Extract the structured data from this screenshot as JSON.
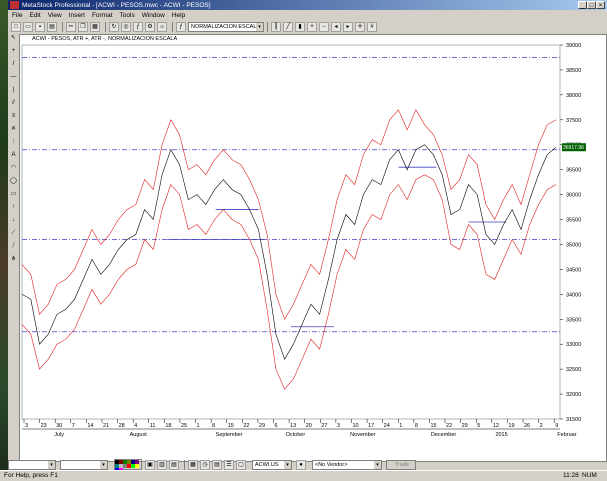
{
  "app": {
    "title": "MetaStock Professional - [ACWI - PESOS.mwc - ACWI - PESOS]"
  },
  "menu": [
    "File",
    "Edit",
    "View",
    "Insert",
    "Format",
    "Tools",
    "Window",
    "Help"
  ],
  "toolbar": {
    "indicator_combo": "NORMALIZACION ESCALA"
  },
  "chart": {
    "header": "ACWI - PESOS, ATR +, ATR -, NORMALIZACION ESCALA",
    "last_value_label": "36917.96"
  },
  "chart_data": {
    "type": "line",
    "title": "ACWI - PESOS, ATR +, ATR -, NORMALIZACION ESCALA",
    "ylim": [
      31500,
      39000
    ],
    "y_ticks": [
      31500,
      32000,
      32500,
      33000,
      33500,
      34000,
      34500,
      35000,
      35500,
      36000,
      36500,
      37000,
      37500,
      38000,
      38500,
      39000
    ],
    "x_tick_labels": [
      "3",
      "23",
      "30",
      "7",
      "14",
      "21",
      "28",
      "4",
      "11",
      "18",
      "25",
      "1",
      "8",
      "15",
      "22",
      "29",
      "6",
      "13",
      "20",
      "27",
      "3",
      "10",
      "17",
      "24",
      "1",
      "8",
      "15",
      "22",
      "29",
      "5",
      "12",
      "19",
      "26",
      "2",
      "9"
    ],
    "month_labels": [
      "July",
      "August",
      "September",
      "October",
      "November",
      "December",
      "2015",
      "Februar"
    ],
    "horizontal_levels": [
      38750,
      36900,
      35100,
      33250
    ],
    "support_segments": [
      {
        "from": 0.27,
        "to": 0.45,
        "y": 35100
      },
      {
        "from": 0.36,
        "to": 0.44,
        "y": 35700
      },
      {
        "from": 0.5,
        "to": 0.58,
        "y": 33350
      },
      {
        "from": 0.7,
        "to": 0.77,
        "y": 36550
      },
      {
        "from": 0.83,
        "to": 0.9,
        "y": 35450
      }
    ],
    "series": [
      {
        "values": [
          34000,
          33900,
          33000,
          33200,
          33600,
          33700,
          33900,
          34300,
          34700,
          34400,
          34600,
          34900,
          35100,
          35200,
          35700,
          35500,
          36400,
          36900,
          36600,
          35900,
          36000,
          35800,
          36100,
          36300,
          36100,
          36000,
          35700,
          35300,
          34400,
          33200,
          32700,
          33000,
          33400,
          33800,
          33600,
          34300,
          35100,
          35600,
          35400,
          36000,
          36300,
          36200,
          36700,
          36900,
          36500,
          36900,
          37000,
          36800,
          36400,
          35600,
          35700,
          36200,
          36000,
          35200,
          35000,
          35400,
          35700,
          35300,
          35900,
          36400,
          36800,
          36950
        ]
      },
      {
        "values": [
          34600,
          34400,
          33600,
          33800,
          34200,
          34300,
          34500,
          34900,
          35300,
          35000,
          35200,
          35500,
          35700,
          35800,
          36300,
          36100,
          37000,
          37500,
          37200,
          36500,
          36600,
          36400,
          36700,
          36900,
          36700,
          36600,
          36300,
          35900,
          35200,
          34000,
          33500,
          33800,
          34200,
          34600,
          34400,
          35100,
          35900,
          36400,
          36200,
          36800,
          37100,
          37000,
          37500,
          37700,
          37300,
          37700,
          37400,
          37200,
          36800,
          36100,
          36300,
          36800,
          36600,
          35800,
          35500,
          35900,
          36200,
          35800,
          36400,
          37000,
          37400,
          37500
        ]
      },
      {
        "values": [
          33400,
          33200,
          32500,
          32700,
          33000,
          33100,
          33300,
          33700,
          34100,
          33800,
          34000,
          34300,
          34500,
          34600,
          35100,
          34900,
          35700,
          36200,
          36000,
          35300,
          35400,
          35200,
          35500,
          35700,
          35500,
          35400,
          35100,
          34700,
          33700,
          32500,
          32100,
          32300,
          32700,
          33100,
          32900,
          33600,
          34400,
          34900,
          34700,
          35300,
          35600,
          35500,
          36000,
          36200,
          35900,
          36300,
          36400,
          36300,
          35900,
          35000,
          34900,
          35400,
          35200,
          34400,
          34300,
          34700,
          35100,
          34800,
          35400,
          35800,
          36100,
          36200
        ]
      }
    ]
  },
  "drawbar": {
    "security_combo": "ACWI.US",
    "vendor_combo": "<No Vendor>",
    "trade_button": "Trade"
  },
  "status": {
    "help": "For Help, press F1",
    "time": "11:28",
    "num": "NUM"
  },
  "colors": {
    "title_bar": "#0a246a",
    "price_line": "#000000",
    "band_line": "#e02020",
    "level_line": "#4040c0"
  }
}
